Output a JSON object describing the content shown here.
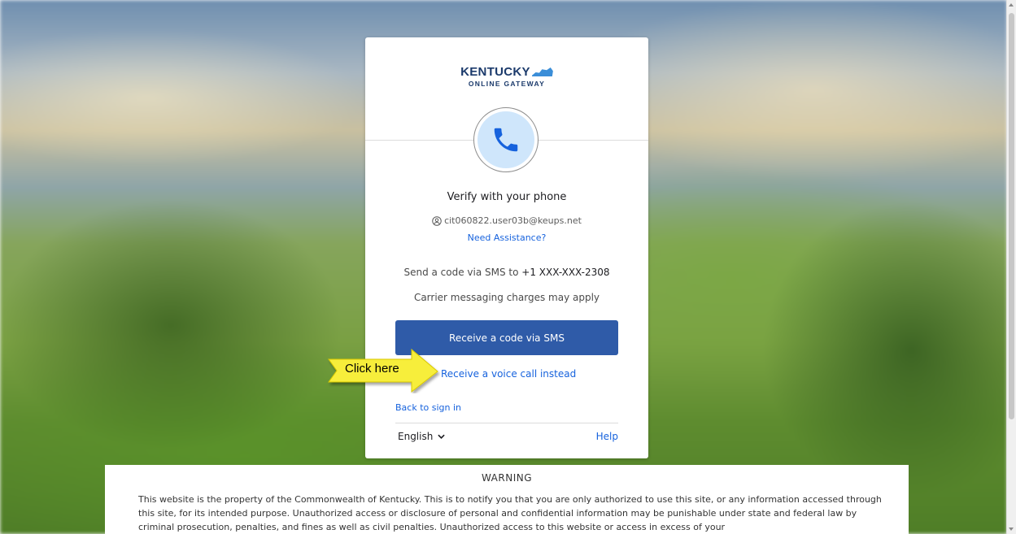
{
  "brand": {
    "name_line1": "KENTUCKY",
    "name_line2": "ONLINE GATEWAY"
  },
  "verify": {
    "title": "Verify with your phone",
    "username": "cit060822.user03b@keups.net",
    "assistance_link": "Need Assistance?",
    "sms_prefix": "Send a code via SMS to ",
    "phone_masked": "+1 XXX-XXX-2308",
    "charges_note": "Carrier messaging charges may apply",
    "primary_button": "Receive a code via SMS",
    "voice_link": "Receive a voice call instead",
    "back_link": "Back to sign in"
  },
  "footer": {
    "language": "English",
    "help": "Help"
  },
  "annotation": {
    "label": "Click here"
  },
  "warning": {
    "title": "WARNING",
    "text": "This website is the property of the Commonwealth of Kentucky. This is to notify you that you are only authorized to use this site, or any information accessed through this site, for its intended purpose. Unauthorized access or disclosure of personal and confidential information may be punishable under state and federal law by criminal prosecution, penalties, and fines as well as civil penalties. Unauthorized access to this website or access in excess of your"
  },
  "colors": {
    "brand_navy": "#1b3a6b",
    "primary_button": "#2f5ba8",
    "link": "#1662dd",
    "phone_icon": "#1662dd",
    "icon_bg": "#cfe6fb",
    "callout_yellow": "#f7ee3a"
  },
  "icons": {
    "phone": "phone-icon",
    "user": "user-icon",
    "language_dropdown": "chevron-down-icon",
    "callout": "arrow-callout-icon"
  }
}
